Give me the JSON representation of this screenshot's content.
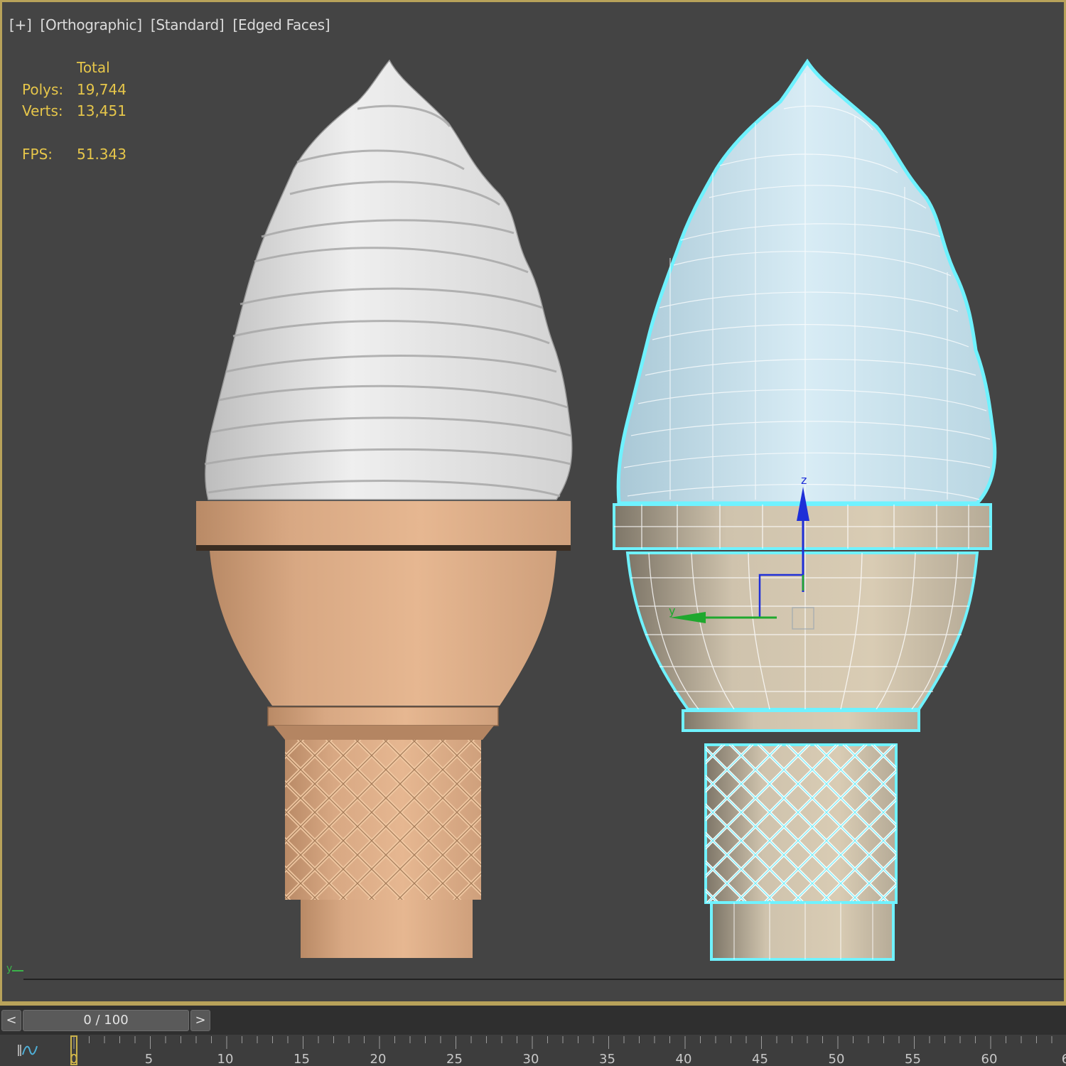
{
  "viewport": {
    "labels": [
      "[+]",
      "[Orthographic]",
      "[Standard]",
      "[Edged Faces]"
    ]
  },
  "stats": {
    "header": "Total",
    "polys_label": "Polys:",
    "polys_value": "19,744",
    "verts_label": "Verts:",
    "verts_value": "13,451",
    "fps_label": "FPS:",
    "fps_value": "51.343"
  },
  "gizmo": {
    "z_label": "z",
    "y_label": "y"
  },
  "mini_axis": {
    "label": "y"
  },
  "timeslider": {
    "prev_label": "<",
    "next_label": ">",
    "frame_text": "0 / 100",
    "current_frame": 0,
    "total_frames": 100
  },
  "ruler": {
    "tick_labels": [
      "0",
      "5",
      "10",
      "15",
      "20",
      "25",
      "30",
      "35",
      "40",
      "45",
      "50",
      "55",
      "60",
      "6"
    ]
  },
  "colors": {
    "viewport_bg": "#444444",
    "frame_border": "#b8a25a",
    "stats_text": "#e6c64a",
    "cone": "#e2b189",
    "cream": "#e9e9e9",
    "selection": "#6ff2ff",
    "gizmo_z": "#1f2fd8",
    "gizmo_y": "#1fa82e"
  }
}
